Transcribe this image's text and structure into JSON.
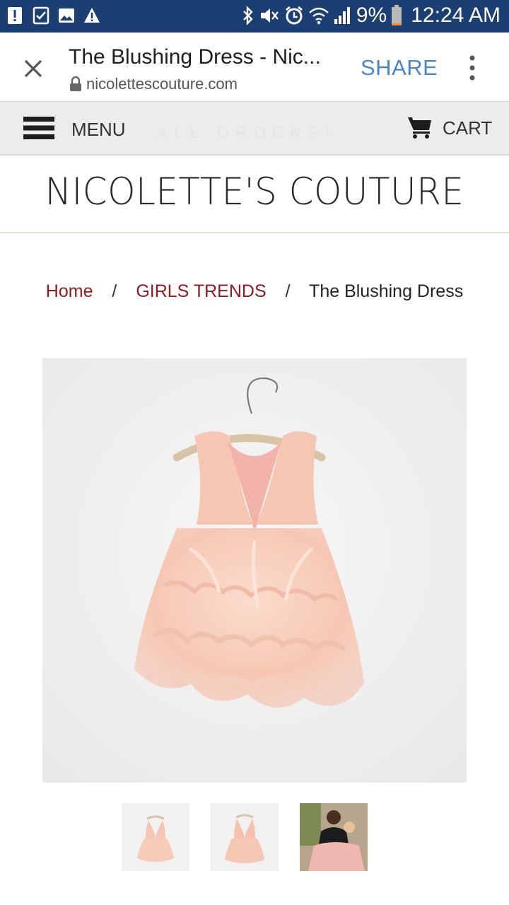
{
  "status_bar": {
    "battery": "9%",
    "time": "12:24 AM",
    "icons": [
      "alert-icon",
      "checklist-icon",
      "gallery-icon",
      "warning-icon",
      "bluetooth-icon",
      "mute-icon",
      "alarm-icon",
      "wifi-icon",
      "signal-icon",
      "battery-icon"
    ]
  },
  "browser": {
    "title": "The Blushing Dress - Nic...",
    "url": "nicolettescouture.com",
    "share_label": "SHARE"
  },
  "site_header": {
    "menu_label": "MENU",
    "announcement": "ALL ORDERS!",
    "cart_label": "CART"
  },
  "logo": "NICOLETTE'S COUTURE",
  "breadcrumb": {
    "home": "Home",
    "separator": "/",
    "category": "GIRLS TRENDS",
    "current": "The Blushing Dress"
  },
  "colors": {
    "status_bar": "#1b3f73",
    "share": "#4a86c6",
    "link": "#8e1c23",
    "dress": "#f6c7b2"
  }
}
